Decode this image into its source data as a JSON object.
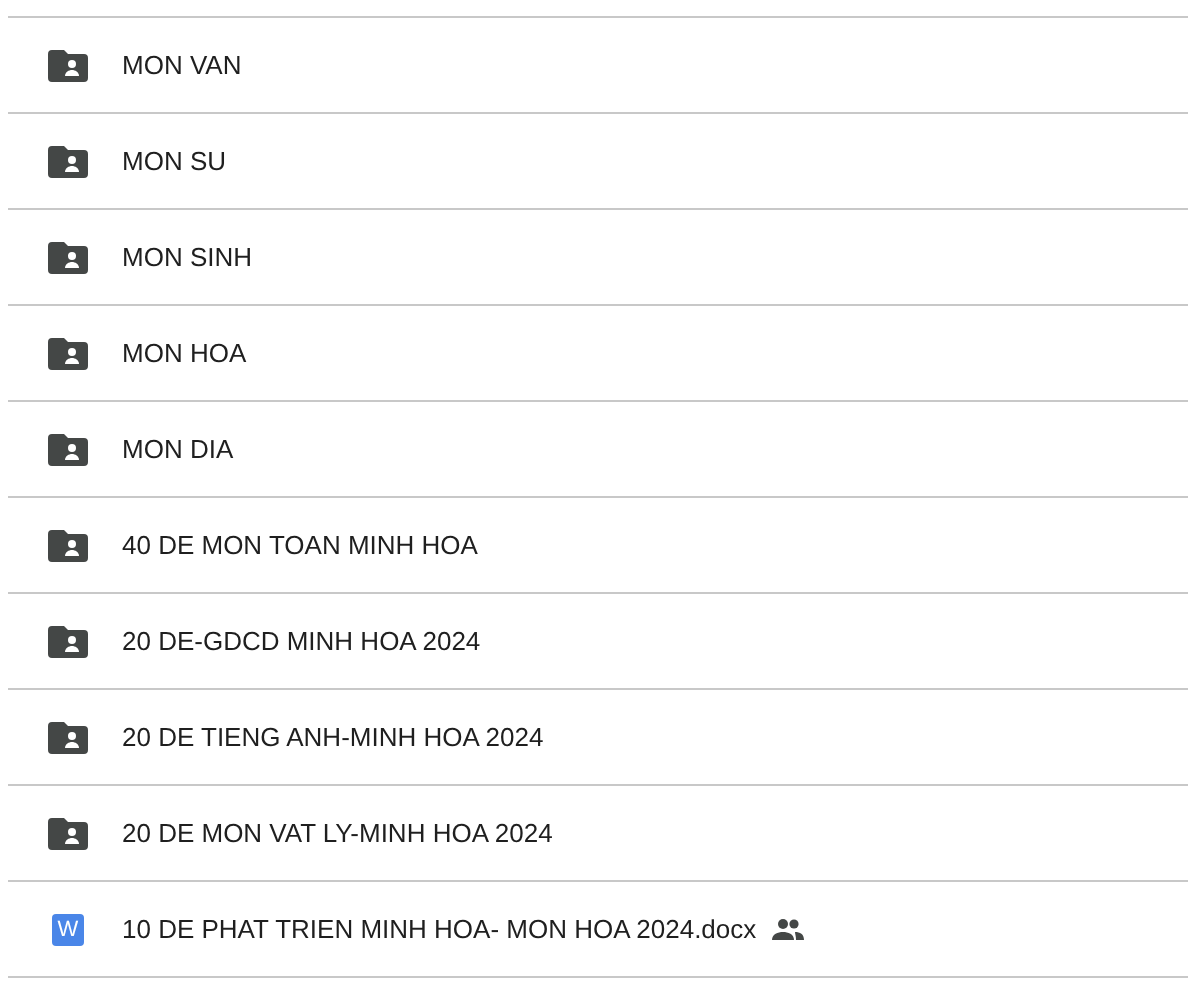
{
  "files": [
    {
      "kind": "folder",
      "name": "MON VAN",
      "shared": false
    },
    {
      "kind": "folder",
      "name": "MON SU",
      "shared": false
    },
    {
      "kind": "folder",
      "name": "MON SINH",
      "shared": false
    },
    {
      "kind": "folder",
      "name": "MON HOA",
      "shared": false
    },
    {
      "kind": "folder",
      "name": "MON DIA",
      "shared": false
    },
    {
      "kind": "folder",
      "name": "40 DE MON TOAN MINH HOA",
      "shared": false
    },
    {
      "kind": "folder",
      "name": "20 DE-GDCD MINH HOA 2024",
      "shared": false
    },
    {
      "kind": "folder",
      "name": "20 DE TIENG ANH-MINH HOA 2024",
      "shared": false
    },
    {
      "kind": "folder",
      "name": "20 DE MON VAT LY-MINH HOA 2024",
      "shared": false
    },
    {
      "kind": "document",
      "name": "10 DE PHAT TRIEN MINH HOA- MON HOA 2024.docx",
      "icon_letter": "W",
      "shared": true
    }
  ]
}
